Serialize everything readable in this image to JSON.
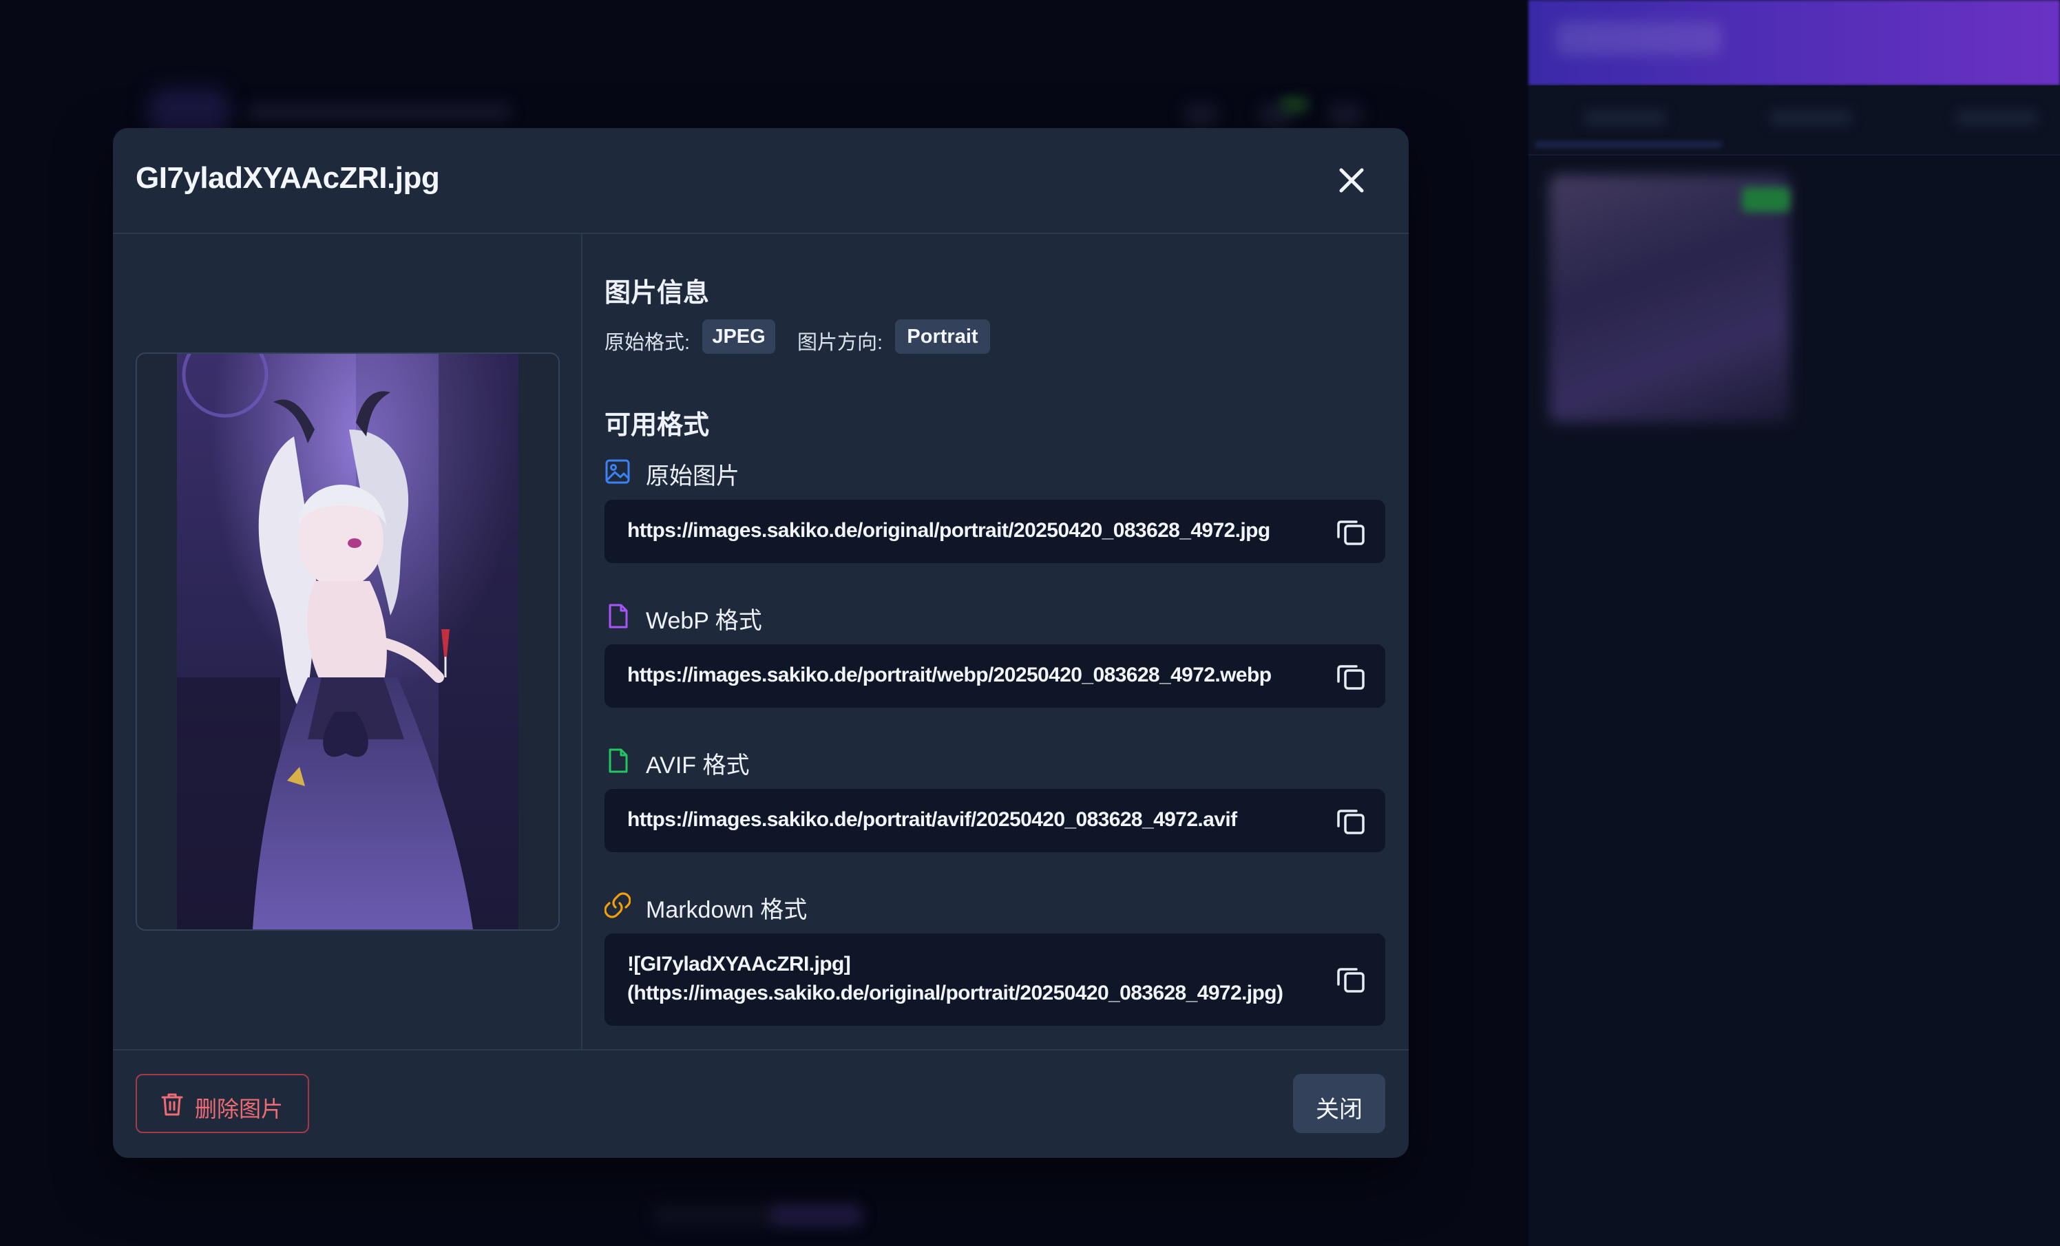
{
  "modal": {
    "title": "GI7yladXYAAcZRI.jpg",
    "info_heading": "图片信息",
    "original_format_label": "原始格式:",
    "original_format_value": "JPEG",
    "orientation_label": "图片方向:",
    "orientation_value": "Portrait",
    "formats_heading": "可用格式",
    "formats": [
      {
        "label": "原始图片",
        "url": "https://images.sakiko.de/original/portrait/20250420_083628_4972.jpg",
        "icon": "image-icon",
        "color": "#3b82f6"
      },
      {
        "label": "WebP 格式",
        "url": "https://images.sakiko.de/portrait/webp/20250420_083628_4972.webp",
        "icon": "file-icon",
        "color": "#a855f7"
      },
      {
        "label": "AVIF 格式",
        "url": "https://images.sakiko.de/portrait/avif/20250420_083628_4972.avif",
        "icon": "file-icon",
        "color": "#22c55e"
      },
      {
        "label": "Markdown 格式",
        "url": "![GI7yladXYAAcZRI.jpg](https://images.sakiko.de/original/portrait/20250420_083628_4972.jpg)",
        "icon": "link-icon",
        "color": "#f59e0b"
      }
    ],
    "delete_label": "删除图片",
    "close_label": "关闭"
  },
  "colors": {
    "modal_bg": "#1e2a3c",
    "url_box_bg": "#0e1627",
    "chip_bg": "#33415a",
    "danger": "#f06b74"
  }
}
